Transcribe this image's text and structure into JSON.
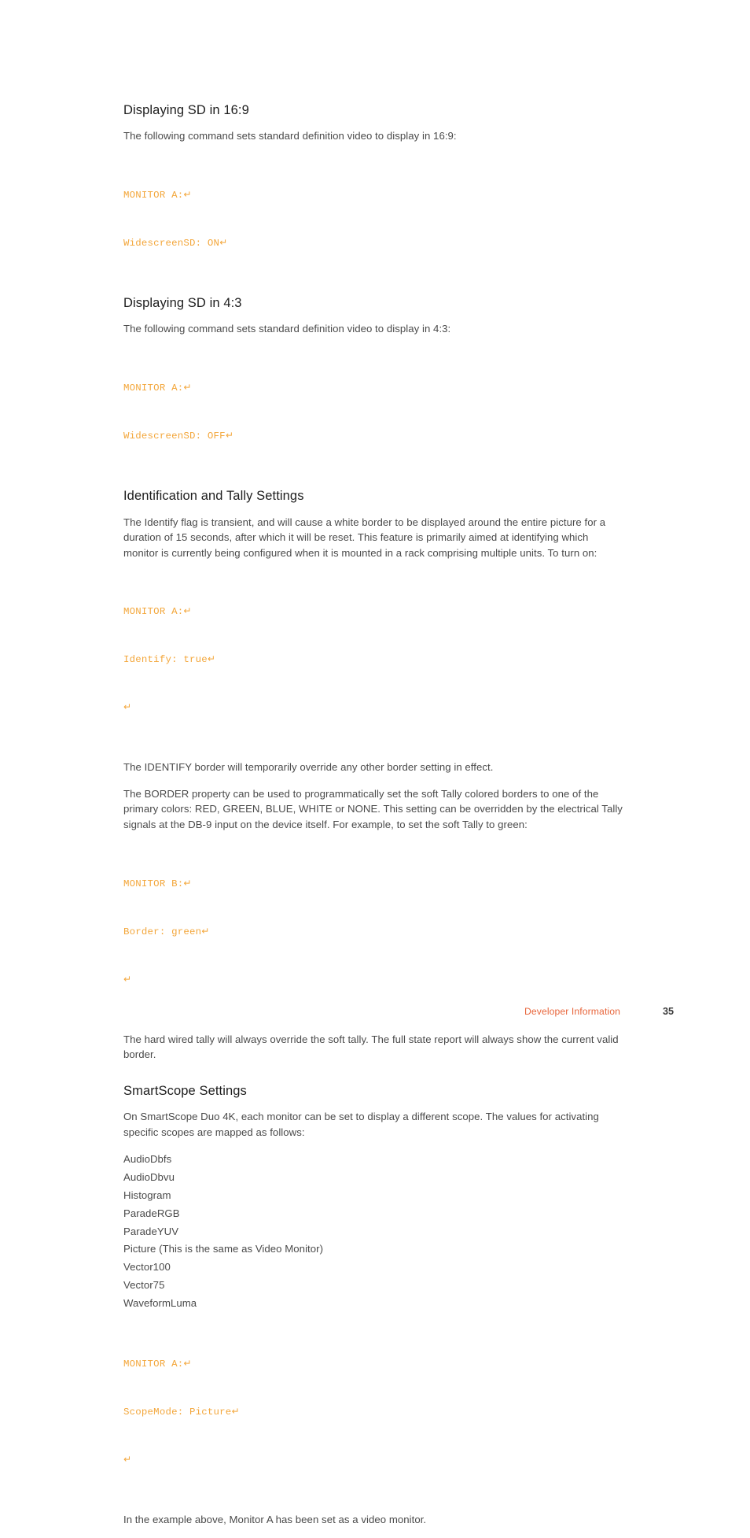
{
  "document": {
    "sections": [
      {
        "heading": "Displaying SD in 16:9",
        "paragraph": "The following command sets standard definition video to display in 16:9:",
        "code": [
          "MONITOR A:",
          "WidescreenSD: ON"
        ]
      },
      {
        "heading": "Displaying SD in 4:3",
        "paragraph": "The following command sets standard definition video to display in 4:3:",
        "code": [
          "MONITOR A:",
          "WidescreenSD: OFF"
        ]
      },
      {
        "heading": "Identification and Tally Settings",
        "paragraph": "The Identify flag is transient, and will cause a white border to be displayed around the entire picture for a duration of 15 seconds, after which it will be reset. This feature is primarily aimed at identifying which monitor is currently being configured when it is mounted in a rack comprising multiple units. To turn on:",
        "code": [
          "MONITOR A:",
          "Identify: true",
          ""
        ],
        "paragraph2": "The IDENTIFY border will temporarily override any other border setting in effect.",
        "paragraph3": "The BORDER property can be used to programmatically set the soft Tally colored borders to one of the primary colors: RED, GREEN, BLUE, WHITE or NONE. This setting can be overridden by the electrical Tally signals at the DB-9 input on the device itself. For example, to set the soft Tally to green:",
        "code2": [
          "MONITOR B:",
          "Border: green",
          ""
        ],
        "paragraph4": "The hard wired tally will always override the soft tally. The full state report will always show the current valid border."
      },
      {
        "heading": "SmartScope Settings",
        "paragraph": "On SmartScope Duo 4K, each monitor can be set to display a different scope. The values for activating specific scopes are mapped as follows:",
        "scope_values": [
          "AudioDbfs",
          "AudioDbvu",
          "Histogram",
          "ParadeRGB",
          "ParadeYUV",
          "Picture (This is the same as Video Monitor)",
          "Vector100",
          "Vector75",
          "WaveformLuma"
        ],
        "code": [
          "MONITOR A:",
          "ScopeMode: Picture",
          ""
        ],
        "paragraph2": "In the example above, Monitor A has been set as a video monitor."
      }
    ],
    "return_glyph": "↵",
    "footer": {
      "link_label": "Developer Information",
      "page_number": "35"
    },
    "colors": {
      "code_orange": "#f3a63a",
      "footer_orange": "#e8663c",
      "heading": "#1d1d1d",
      "body": "#4a4a4a"
    }
  }
}
